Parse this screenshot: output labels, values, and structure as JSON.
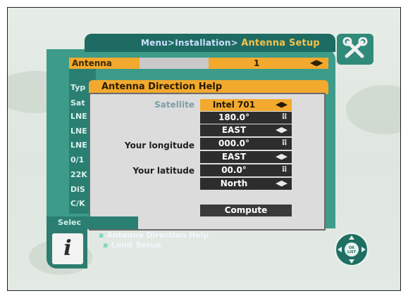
{
  "breadcrumb": {
    "path": "Menu>Installation>",
    "current": "Antenna Setup"
  },
  "background_list": {
    "antenna_label": "Antenna",
    "antenna_value": "1",
    "rows": [
      "Typ",
      "Sat",
      "LNE",
      "LNE",
      "LNE",
      "0/1",
      "22K",
      "DiS",
      "C/K"
    ]
  },
  "dialog": {
    "title": "Antenna Direction Help",
    "labels": {
      "satellite": "Satellite",
      "your_longitude": "Your longitude",
      "your_latitude": "Your latitude"
    },
    "fields": [
      {
        "value": "Intel 701",
        "icon": "left-right-arrows-icon",
        "selected": true
      },
      {
        "value": "180.0°",
        "icon": "keypad-icon",
        "selected": false
      },
      {
        "value": "EAST",
        "icon": "left-right-arrows-icon",
        "selected": false
      },
      {
        "value": "000.0°",
        "icon": "keypad-icon",
        "selected": false
      },
      {
        "value": "EAST",
        "icon": "left-right-arrows-icon",
        "selected": false
      },
      {
        "value": "00.0°",
        "icon": "keypad-icon",
        "selected": false
      },
      {
        "value": "North",
        "icon": "left-right-arrows-icon",
        "selected": false
      }
    ],
    "compute_label": "Compute"
  },
  "bottom": {
    "select_label": "Selec",
    "hints": [
      "Antenna Direction Help",
      "Limit Setup"
    ]
  },
  "colors": {
    "panel": "#3d9b89",
    "accent": "#f2a92d",
    "field_bg": "#2d2d2d"
  }
}
